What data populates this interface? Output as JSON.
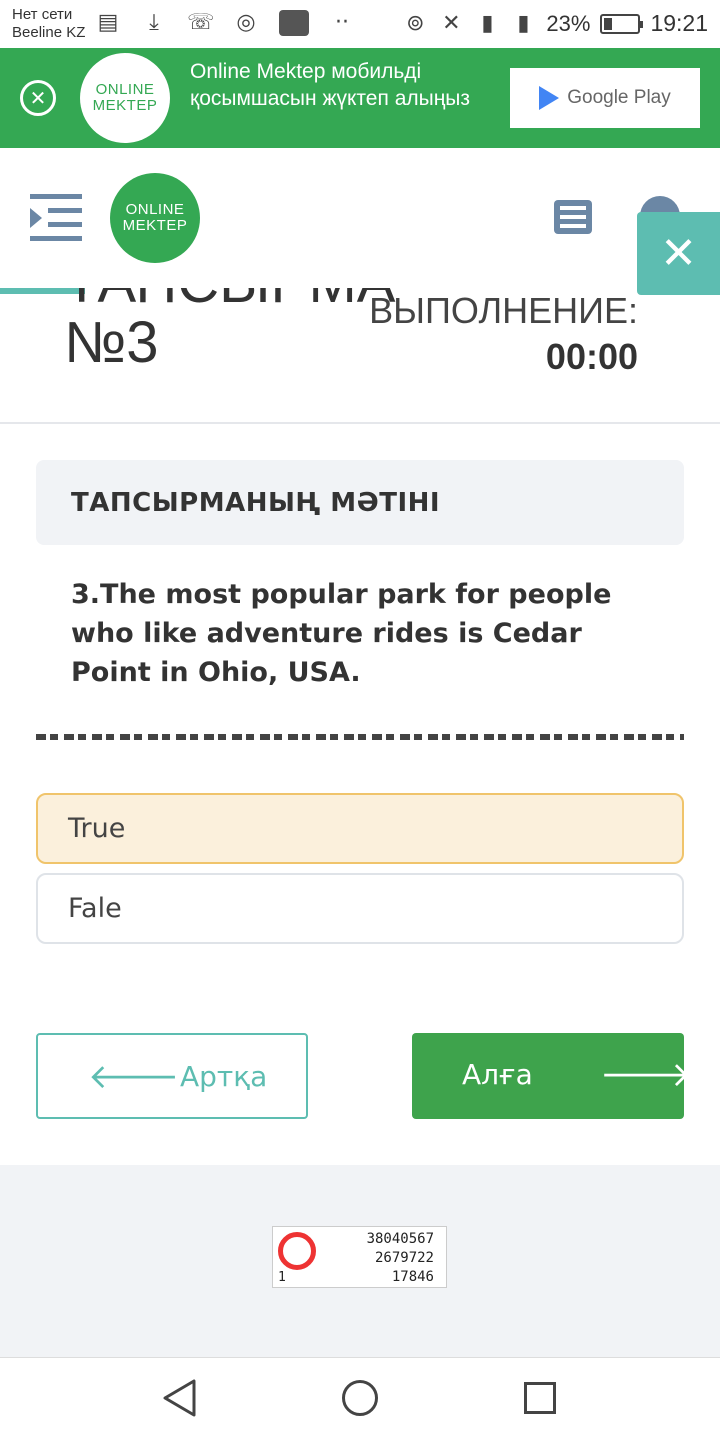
{
  "status_bar": {
    "carrier_line1": "Нет сети",
    "carrier_line2": "Beeline KZ",
    "battery_percent": "23%",
    "battery_level": 0.23,
    "time": "19:21"
  },
  "banner": {
    "logo_line1": "ONLINE",
    "logo_line2": "MEKTEP",
    "text": "Online Mektep мобильді қосымшасын жүктеп алыңыз",
    "store_label": "Google Play"
  },
  "header": {
    "logo_line1": "ONLINE",
    "logo_line2": "MEKTEP"
  },
  "task": {
    "title_line1": "ТАПСЫРМА",
    "title_line2": "№3",
    "exec_label": "ВЫПОЛНЕНИЕ:",
    "exec_time": "00:00"
  },
  "card": {
    "heading": "ТАПСЫРМАНЫҢ МӘТІНІ",
    "question": "3.The most popular park for people who like adventure rides is Cedar Point in Ohio, USA."
  },
  "options": [
    {
      "label": "True",
      "selected": true
    },
    {
      "label": "Fale",
      "selected": false
    }
  ],
  "nav": {
    "back_label": "Артқа",
    "next_label": "Алға"
  },
  "counter": {
    "line1": "38040567",
    "line2": "2679722",
    "line3": "17846",
    "left_digit": "1"
  },
  "colors": {
    "brand_green": "#34a853",
    "teal": "#5dbdb1",
    "selected_bg": "#fbf0dc",
    "selected_border": "#f0c46b"
  }
}
